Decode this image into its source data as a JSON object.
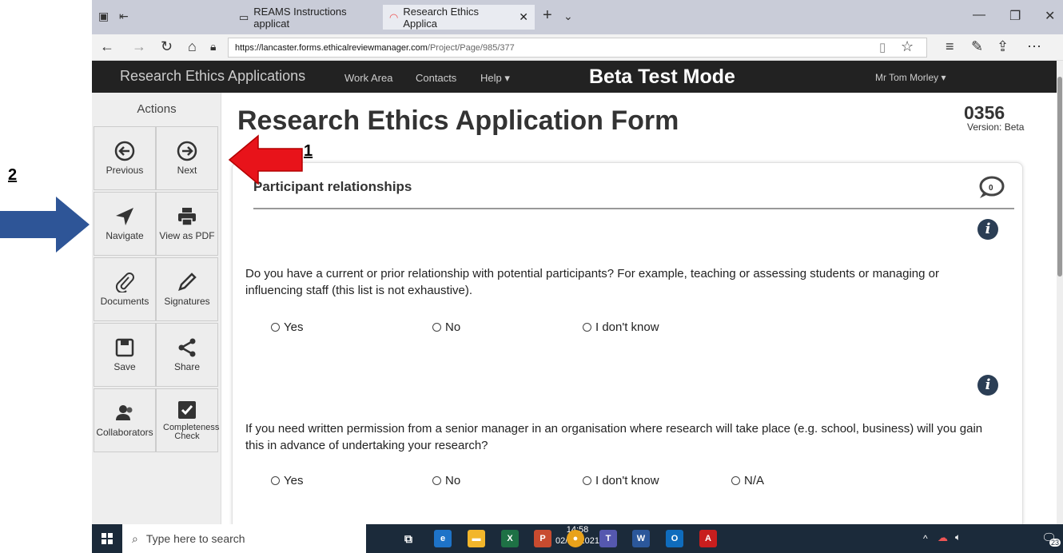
{
  "browser": {
    "tabs": [
      {
        "label": "REAMS Instructions applicat",
        "active": false
      },
      {
        "label": "Research Ethics Applica",
        "active": true
      }
    ],
    "url_domain": "https://lancaster.forms.ethicalreviewmanager.com",
    "url_path": "/Project/Page/985/377"
  },
  "site": {
    "brand": "Research Ethics Applications",
    "nav": [
      "Work Area",
      "Contacts",
      "Help ▾"
    ],
    "banner": "Beta Test Mode",
    "user": "Mr Tom Morley ▾"
  },
  "sidebar": {
    "heading": "Actions",
    "buttons": [
      {
        "label": "Previous",
        "icon": "arrow-left-circle-icon"
      },
      {
        "label": "Next",
        "icon": "arrow-right-circle-icon"
      },
      {
        "label": "Navigate",
        "icon": "navigate-arrow-icon"
      },
      {
        "label": "View as PDF",
        "icon": "printer-icon"
      },
      {
        "label": "Documents",
        "icon": "paperclip-icon"
      },
      {
        "label": "Signatures",
        "icon": "pencil-icon"
      },
      {
        "label": "Save",
        "icon": "floppy-disk-icon"
      },
      {
        "label": "Share",
        "icon": "share-icon"
      },
      {
        "label": "Collaborators",
        "icon": "users-icon"
      },
      {
        "label": "Completeness Check",
        "icon": "checkbox-icon"
      }
    ]
  },
  "form": {
    "title": "Research Ethics Application Form",
    "project_number": "0356",
    "version": "Version: Beta",
    "section_title": "Participant relationships",
    "comment_count": "0",
    "questions": [
      {
        "text": "Do you have a current or prior relationship with potential participants? For example, teaching or assessing students or managing or influencing staff (this list is not exhaustive).",
        "options": [
          "Yes",
          "No",
          "I don't know"
        ]
      },
      {
        "text": "If you need written permission from a senior manager in an organisation where research will take place (e.g. school, business) will you gain this in advance of undertaking your research?",
        "options": [
          "Yes",
          "No",
          "I don't know",
          "N/A"
        ]
      }
    ]
  },
  "annotations": {
    "label_1": "1",
    "label_2": "2",
    "arrow_1_color": "#e8131a",
    "arrow_2_color": "#2e5597"
  },
  "taskbar": {
    "search_placeholder": "Type here to search",
    "time": "14:58",
    "date": "02/06/2021",
    "notification_count": "23"
  }
}
